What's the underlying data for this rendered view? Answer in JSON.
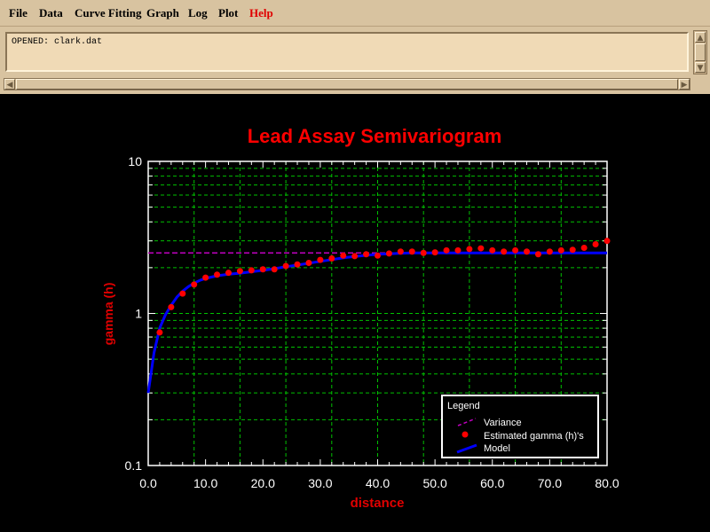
{
  "menu": {
    "items": [
      "File",
      "Data",
      "Curve Fitting",
      "Graph",
      "Log",
      "Plot"
    ],
    "help": "Help"
  },
  "log": {
    "text": "OPENED: clark.dat"
  },
  "colors": {
    "title": "#ff0000",
    "axis_label": "#e00000",
    "grid": "#00c000",
    "variance": "#c000c0",
    "points": "#ff0000",
    "model": "#0000ff"
  },
  "chart_data": {
    "type": "scatter",
    "title": "Lead Assay Semivariogram",
    "xlabel": "distance",
    "ylabel": "gamma (h)",
    "xlim": [
      0,
      80
    ],
    "ylim": [
      0.1,
      10
    ],
    "yscale": "log",
    "grid": true,
    "legend_position": "bottom-right",
    "legend_title": "Legend",
    "x_ticks": [
      "0.0",
      "10.0",
      "20.0",
      "30.0",
      "40.0",
      "50.0",
      "60.0",
      "70.0",
      "80.0"
    ],
    "y_ticks": [
      "0.1",
      "1",
      "10"
    ],
    "series": [
      {
        "name": "Variance",
        "kind": "line",
        "style": "dashed",
        "x": [
          0,
          80
        ],
        "y": [
          2.5,
          2.5
        ]
      },
      {
        "name": "Estimated gamma (h)'s",
        "kind": "points",
        "x": [
          2,
          4,
          6,
          8,
          10,
          12,
          14,
          16,
          18,
          20,
          22,
          24,
          26,
          28,
          30,
          32,
          34,
          36,
          38,
          40,
          42,
          44,
          46,
          48,
          50,
          52,
          54,
          56,
          58,
          60,
          62,
          64,
          66,
          68,
          70,
          72,
          74,
          76,
          78,
          80
        ],
        "y": [
          0.75,
          1.1,
          1.35,
          1.55,
          1.72,
          1.8,
          1.85,
          1.9,
          1.92,
          1.95,
          1.95,
          2.05,
          2.1,
          2.15,
          2.25,
          2.3,
          2.4,
          2.38,
          2.45,
          2.4,
          2.48,
          2.55,
          2.55,
          2.5,
          2.52,
          2.6,
          2.6,
          2.65,
          2.68,
          2.6,
          2.55,
          2.6,
          2.55,
          2.45,
          2.55,
          2.6,
          2.62,
          2.7,
          2.85,
          3.0
        ]
      },
      {
        "name": "Model",
        "kind": "line",
        "style": "solid",
        "x": [
          0,
          1,
          2,
          3,
          4,
          5,
          6,
          7,
          8,
          9,
          10,
          12,
          14,
          16,
          18,
          20,
          22,
          24,
          26,
          28,
          30,
          32,
          34,
          36,
          38,
          40,
          42,
          44,
          46,
          48,
          50,
          55,
          60,
          65,
          70,
          75,
          80
        ],
        "y": [
          0.3,
          0.55,
          0.8,
          0.98,
          1.13,
          1.28,
          1.4,
          1.5,
          1.58,
          1.65,
          1.7,
          1.77,
          1.81,
          1.84,
          1.88,
          1.92,
          1.97,
          2.03,
          2.08,
          2.14,
          2.2,
          2.26,
          2.32,
          2.37,
          2.41,
          2.45,
          2.47,
          2.49,
          2.5,
          2.5,
          2.5,
          2.5,
          2.5,
          2.5,
          2.5,
          2.5,
          2.5
        ]
      }
    ]
  }
}
